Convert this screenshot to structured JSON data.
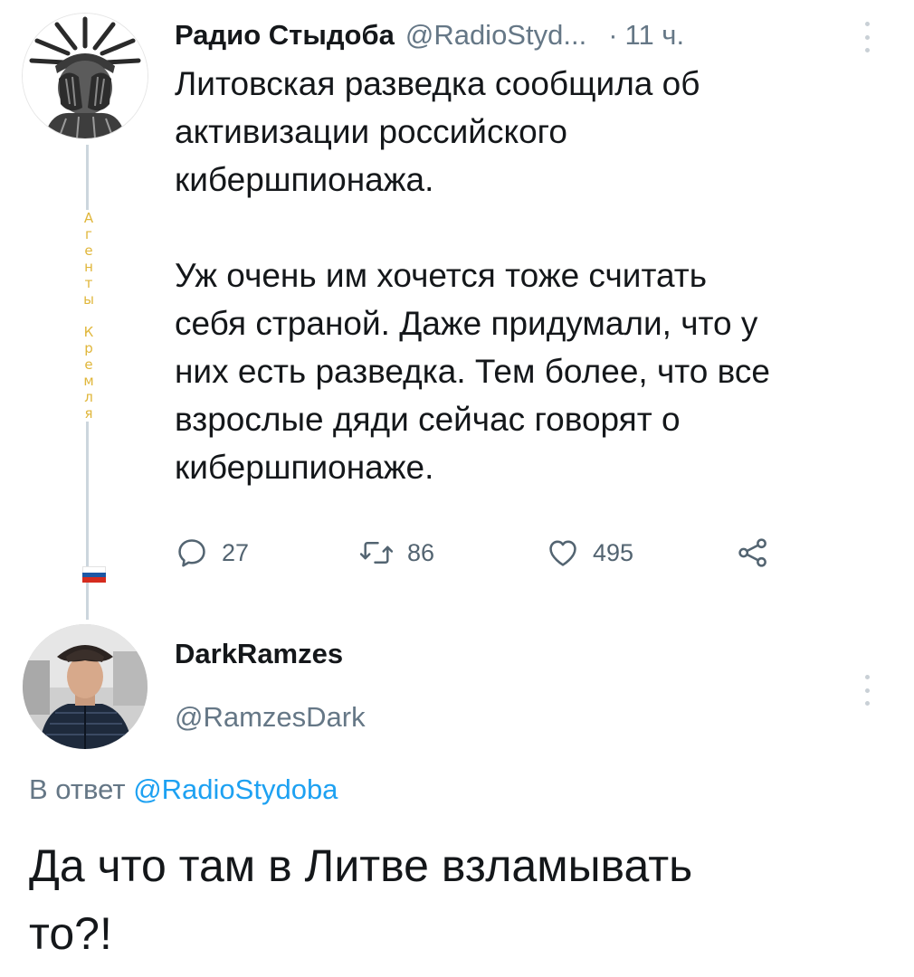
{
  "colors": {
    "text": "#14171a",
    "muted": "#657786",
    "link": "#1da1f2",
    "thread_line": "#ccd6dd",
    "side_text": "#e0b63a"
  },
  "tweet1": {
    "author_name": "Радио Стыдоба",
    "author_handle": "@RadioStyd...",
    "separator": "·",
    "time": "11 ч.",
    "more_icon": "vertical-ellipsis-icon",
    "avatar_icon": "statue-of-liberty-facepalm-avatar",
    "text": "Литовская разведка сообщила об\nактивизации российского\nкибершпионажа.\n\nУж очень им хочется тоже считать\nсебя страной. Даже придумали, что у\nних есть разведка. Тем более, что все\nвзрослые дяди сейчас говорят о\nкибершпионаже.",
    "side_label": [
      "А",
      "г",
      "е",
      "н",
      "т",
      "ы",
      "",
      "К",
      "р",
      "е",
      "м",
      "л",
      "я"
    ],
    "side_flag_icon": "russian-flag-icon",
    "actions": {
      "reply": {
        "icon": "reply-icon",
        "count": "27"
      },
      "retweet": {
        "icon": "retweet-icon",
        "count": "86"
      },
      "like": {
        "icon": "heart-icon",
        "count": "495"
      },
      "share": {
        "icon": "share-icon"
      }
    }
  },
  "tweet2": {
    "author_name": "DarkRamzes",
    "author_handle": "@RamzesDark",
    "more_icon": "vertical-ellipsis-icon",
    "avatar_icon": "man-with-tricorn-hat-avatar",
    "reply_prefix": "В ответ",
    "reply_mention": "@RadioStydoba",
    "text": "Да что там в Литве взламывать\nто?!"
  }
}
